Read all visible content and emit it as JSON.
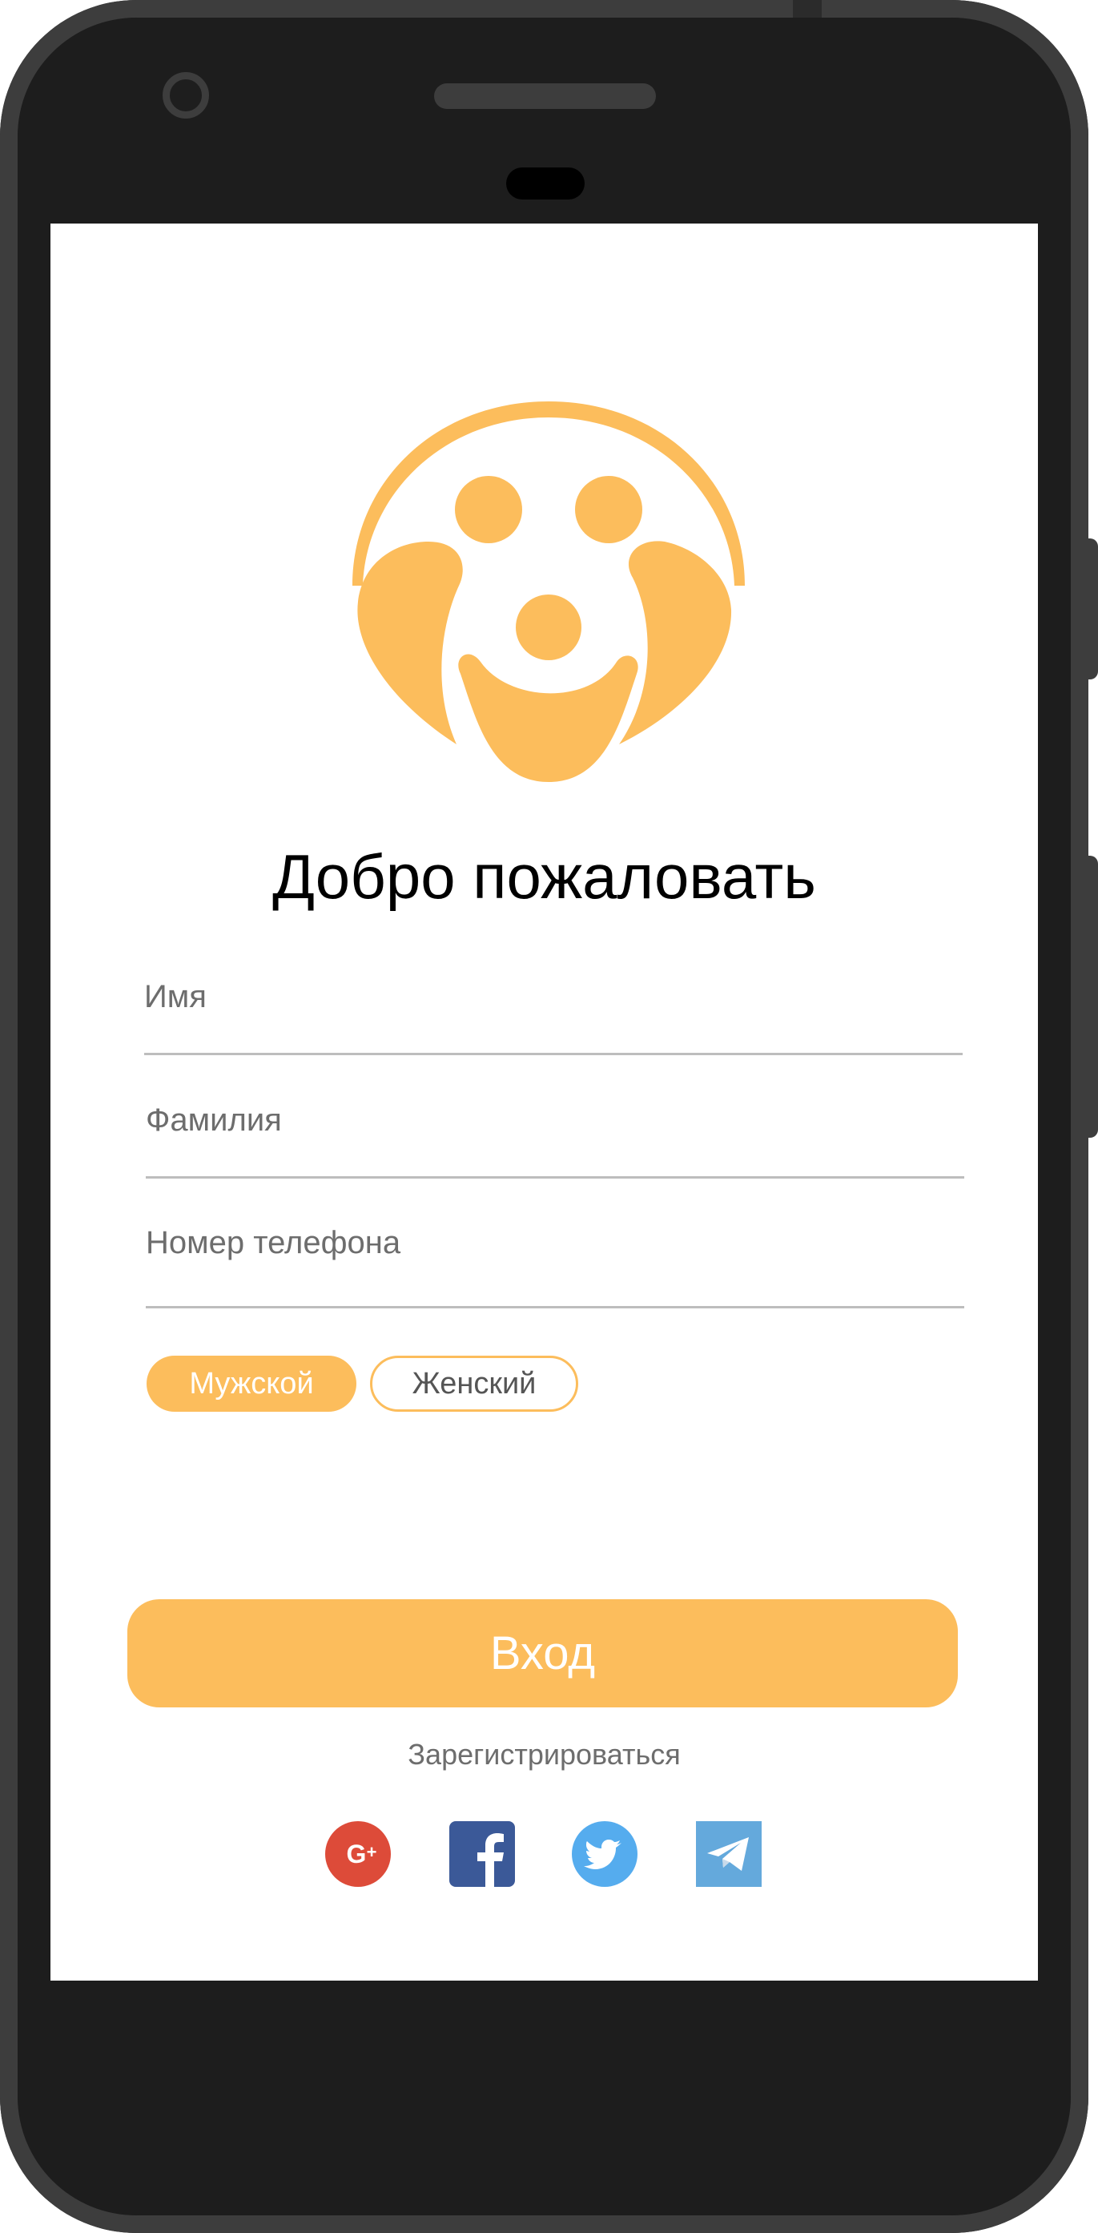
{
  "screen": {
    "title": "Добро пожаловать",
    "logo": "smiling-face-logo"
  },
  "form": {
    "first_name_placeholder": "Имя",
    "last_name_placeholder": "Фамилия",
    "phone_placeholder": "Номер телефона"
  },
  "gender": {
    "options": [
      "Мужской",
      "Женский"
    ],
    "selected": "Мужской"
  },
  "actions": {
    "login_label": "Вход",
    "register_label": "Зарегистрироваться"
  },
  "social": [
    {
      "name": "google-plus-icon",
      "color": "#dd4b39"
    },
    {
      "name": "facebook-icon",
      "color": "#3b5998"
    },
    {
      "name": "twitter-icon",
      "color": "#55acee"
    },
    {
      "name": "telegram-icon",
      "color": "#64a9dc"
    }
  ],
  "colors": {
    "accent": "#fcbd5c",
    "phone_body": "#1e1e1e",
    "phone_bezel": "#3d3d3d"
  }
}
